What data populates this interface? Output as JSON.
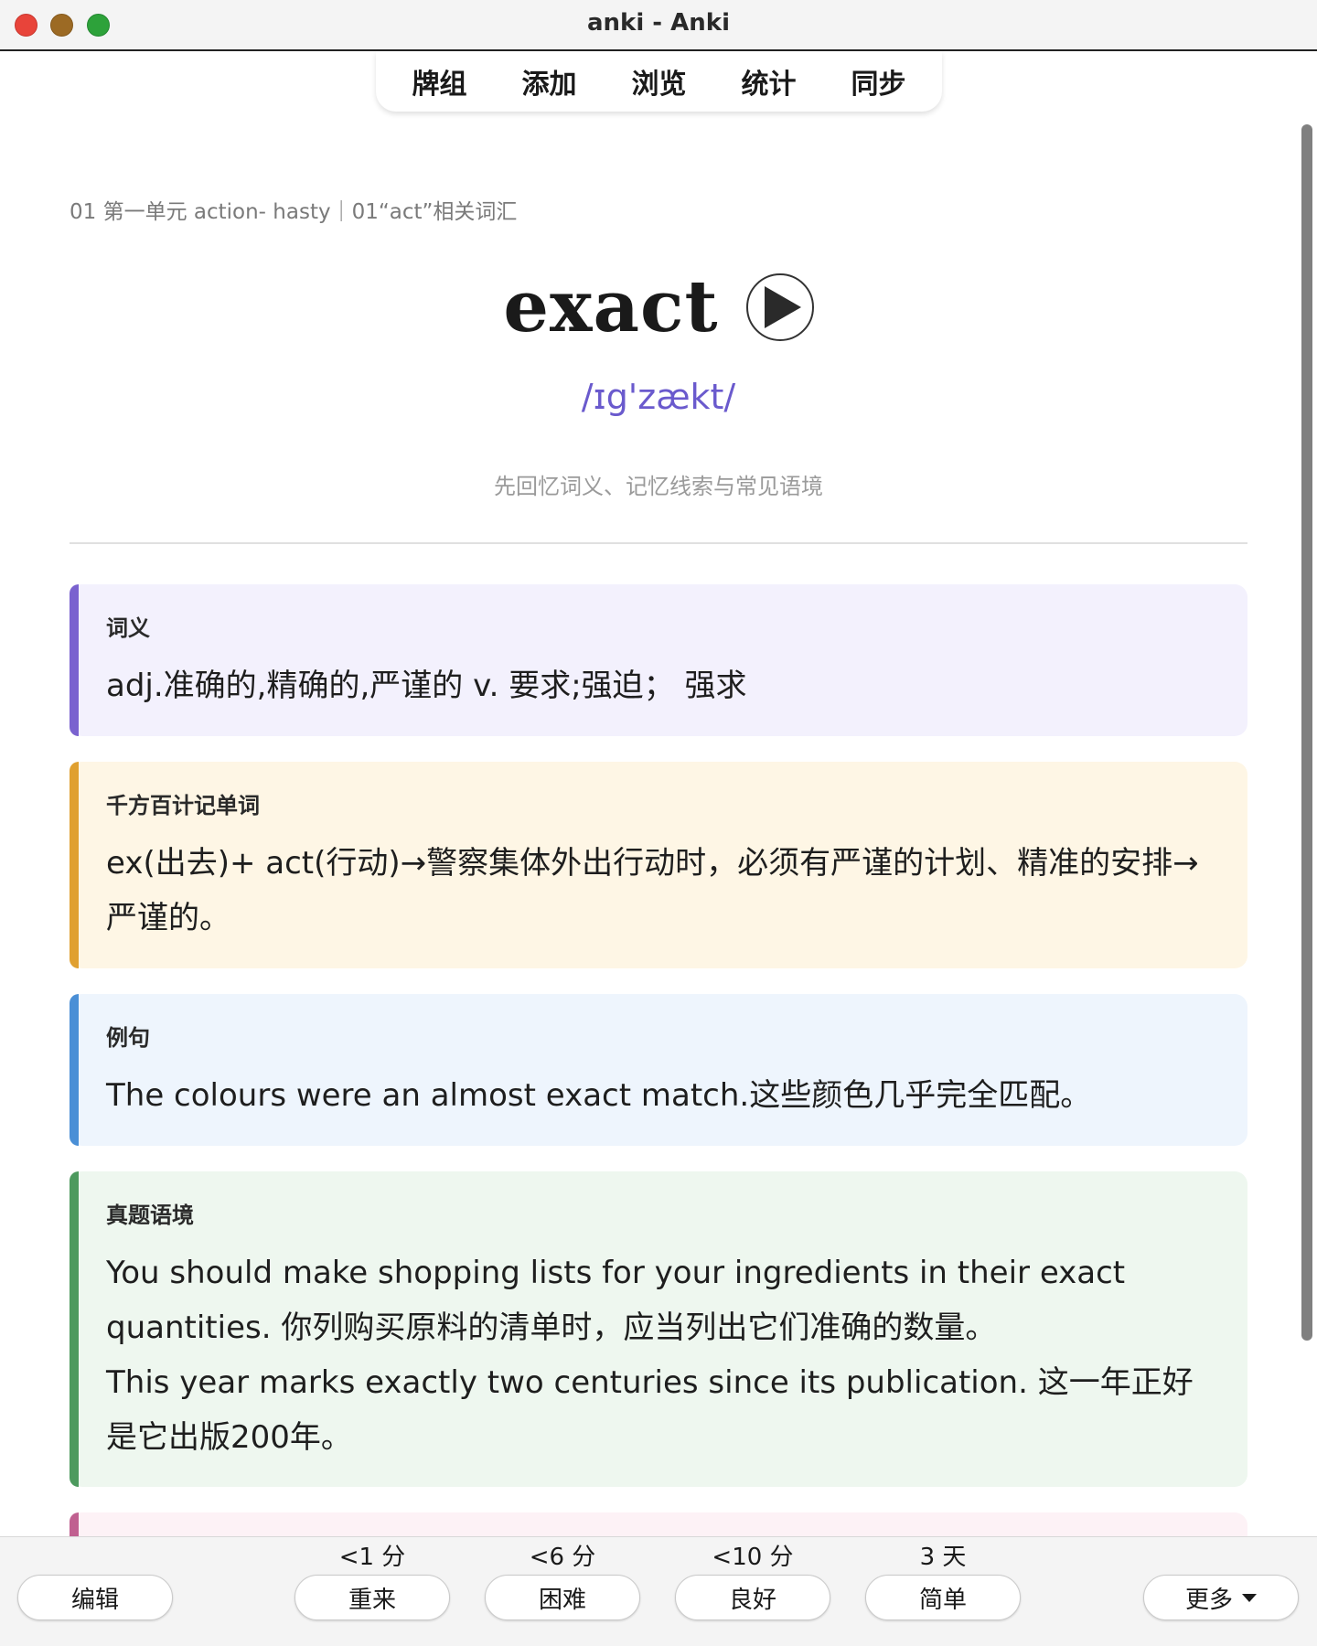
{
  "window": {
    "title": "anki - Anki"
  },
  "nav": {
    "items": [
      "牌组",
      "添加",
      "浏览",
      "统计",
      "同步"
    ]
  },
  "card": {
    "breadcrumb": "01 第一单元 action- hasty｜01“act”相关词汇",
    "word": "exact",
    "phonetic": "/ɪg'zækt/",
    "hint": "先回忆词义、记忆线索与常见语境",
    "sections": {
      "meaning": {
        "title": "词义",
        "text": "adj.准确的,精确的,严谨的 v. 要求;强迫；  强求"
      },
      "memory": {
        "title": "千方百计记单词",
        "text": "ex(出去)+ act(行动)→警察集体外出行动时，必须有严谨的计划、精准的安排→严谨的。"
      },
      "example": {
        "title": "例句",
        "text": "The colours were an almost exact match.这些颜色几乎完全匹配。"
      },
      "exam": {
        "title": "真题语境",
        "line1": "You should make shopping lists for your ingredients in their exact quantities. 你列购买原料的清单时，应当列出它们准确的数量。",
        "line2": "This year marks exactly two centuries since its publication. 这一年正好是它出版200年。"
      }
    },
    "colors": {
      "meaning_accent": "#7a62cf",
      "memory_accent": "#e0a030",
      "example_accent": "#4a8fd6",
      "exam_accent": "#4d9a5e",
      "phonetic": "#6a5acd"
    }
  },
  "bottom": {
    "edit_label": "编辑",
    "more_label": "更多",
    "answers": [
      {
        "interval": "<1 分",
        "label": "重来"
      },
      {
        "interval": "<6 分",
        "label": "困难"
      },
      {
        "interval": "<10 分",
        "label": "良好"
      },
      {
        "interval": "3 天",
        "label": "简单"
      }
    ]
  },
  "icons": {
    "play": "play-icon",
    "more_caret": "caret-down-icon"
  }
}
